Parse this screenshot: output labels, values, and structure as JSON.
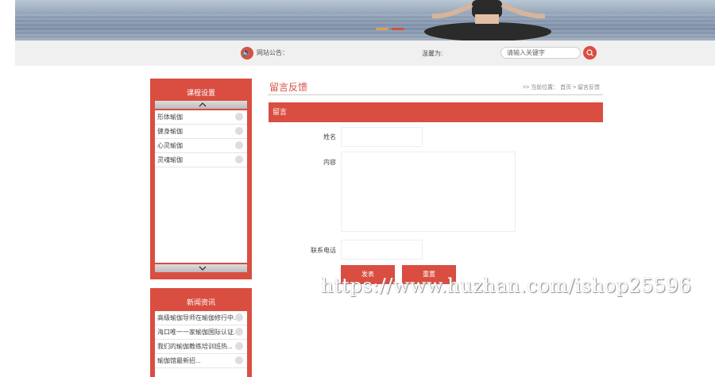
{
  "header": {
    "notice_label": "网站公告：",
    "notice_text": "温馨为:",
    "search_placeholder": "请输入关键字"
  },
  "sidebar": {
    "courses_title": "课程设置",
    "courses": [
      {
        "label": "形体瑜伽"
      },
      {
        "label": "健身瑜伽"
      },
      {
        "label": "心灵瑜伽"
      },
      {
        "label": "灵魂瑜伽"
      }
    ],
    "news_title": "新闻资讯",
    "news": [
      {
        "label": "高级瑜伽导师在瑜伽修行中..."
      },
      {
        "label": "海口唯一一家瑜伽国际认证..."
      },
      {
        "label": "我们的瑜伽教练培训班热..."
      },
      {
        "label": "瑜伽馆最新招..."
      }
    ]
  },
  "main": {
    "page_title": "留言反馈",
    "breadcrumb": ">> 当前位置： 首页 > 留言反馈",
    "section_title": "留言",
    "form": {
      "name_label": "姓名",
      "content_label": "内容",
      "phone_label": "联系电话",
      "submit_label": "发表",
      "reset_label": "重置"
    }
  },
  "watermark": "https://www.huzhan.com/ishop25596",
  "colors": {
    "accent": "#d94e41",
    "bar": "#f0f0f0"
  }
}
